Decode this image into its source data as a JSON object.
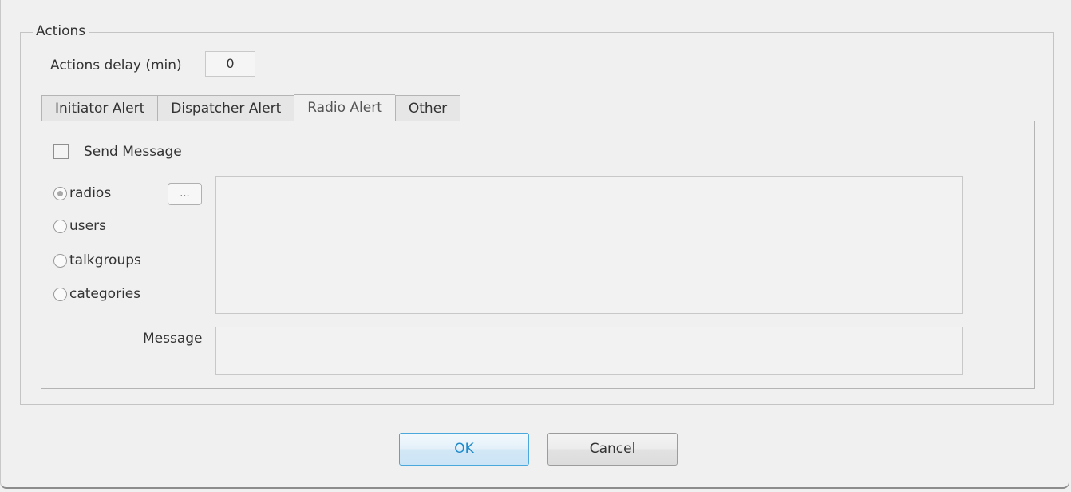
{
  "actions": {
    "legend": "Actions",
    "delay_label": "Actions delay (min)",
    "delay_value": "0"
  },
  "tabs": [
    {
      "label": "Initiator Alert",
      "active": false
    },
    {
      "label": "Dispatcher Alert",
      "active": false
    },
    {
      "label": "Radio Alert",
      "active": true
    },
    {
      "label": "Other",
      "active": false
    }
  ],
  "panel": {
    "send_message_label": "Send Message",
    "send_message_checked": false,
    "recipients": [
      {
        "label": "radios",
        "selected": true
      },
      {
        "label": "users",
        "selected": false
      },
      {
        "label": "talkgroups",
        "selected": false
      },
      {
        "label": "categories",
        "selected": false
      }
    ],
    "browse_label": "...",
    "message_label": "Message",
    "message_value": ""
  },
  "buttons": {
    "ok": "OK",
    "cancel": "Cancel"
  },
  "colors": {
    "ok_accent": "#1d8acb",
    "background": "#f0f0f0"
  }
}
